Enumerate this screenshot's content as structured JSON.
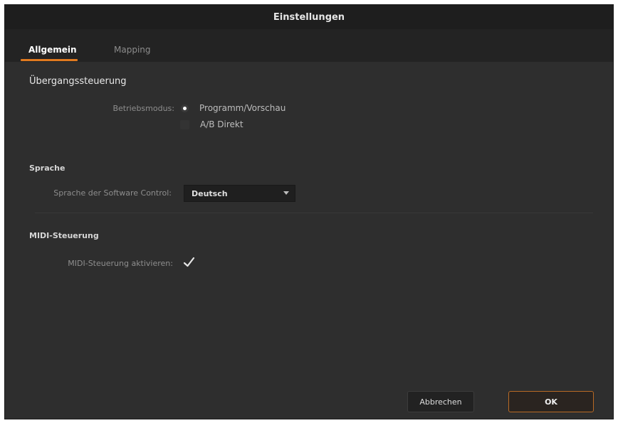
{
  "window": {
    "title": "Einstellungen"
  },
  "tabs": [
    {
      "label": "Allgemein",
      "active": true
    },
    {
      "label": "Mapping",
      "active": false
    }
  ],
  "transition": {
    "title": "Übergangssteuerung",
    "mode_label": "Betriebsmodus:",
    "options": [
      {
        "label": "Programm/Vorschau",
        "selected": true
      },
      {
        "label": "A/B Direkt",
        "selected": false
      }
    ]
  },
  "language": {
    "title": "Sprache",
    "label": "Sprache der Software Control:",
    "selected": "Deutsch"
  },
  "midi": {
    "title": "MIDI-Steuerung",
    "enable_label": "MIDI-Steuerung aktivieren:",
    "enabled": true
  },
  "footer": {
    "cancel_label": "Abbrechen",
    "ok_label": "OK"
  },
  "colors": {
    "accent": "#e07a1f",
    "background": "#2e2e2e",
    "titlebar": "#1e1e1e"
  },
  "icons": {
    "dropdown": "chevron-down-icon",
    "check": "checkmark-icon"
  }
}
